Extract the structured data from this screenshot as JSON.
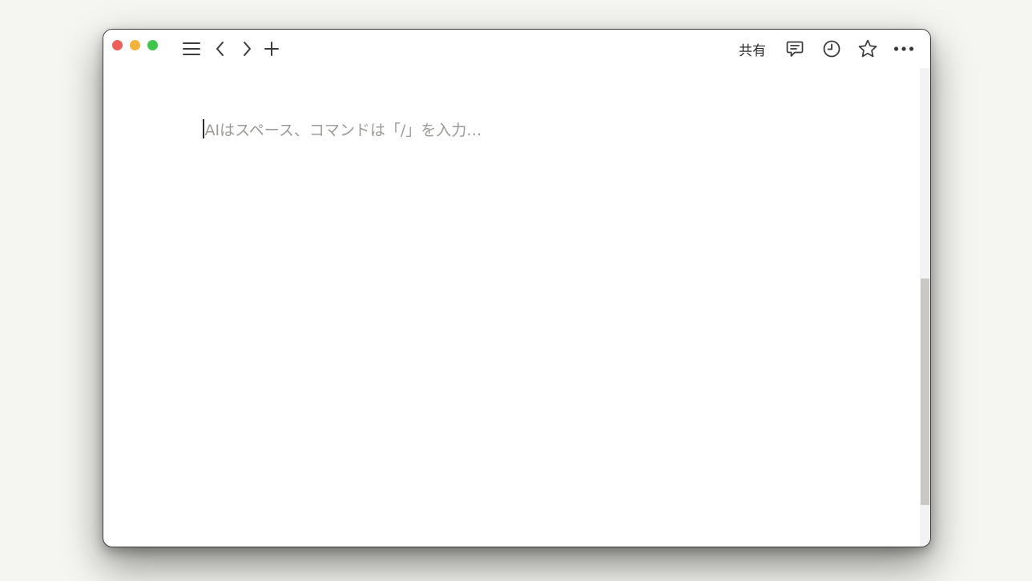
{
  "window": {
    "traffic_lights": {
      "close_color": "#ee5f57",
      "minimize_color": "#f3b33c",
      "maximize_color": "#3ec54a"
    }
  },
  "toolbar": {
    "left_icons": [
      "menu-icon",
      "chevron-left-icon",
      "chevron-right-icon",
      "plus-icon"
    ],
    "share_label": "共有",
    "right_icons": [
      "comment-icon",
      "clock-icon",
      "star-icon",
      "more-horizontal-icon"
    ]
  },
  "editor": {
    "placeholder": "AIはスペース、コマンドは「/」を入力…"
  },
  "colors": {
    "desktop_background": "#f5f5f1",
    "placeholder_text": "#9b9a97",
    "icon": "#3a3a3a",
    "scrollbar_thumb": "#c9c8c4"
  }
}
